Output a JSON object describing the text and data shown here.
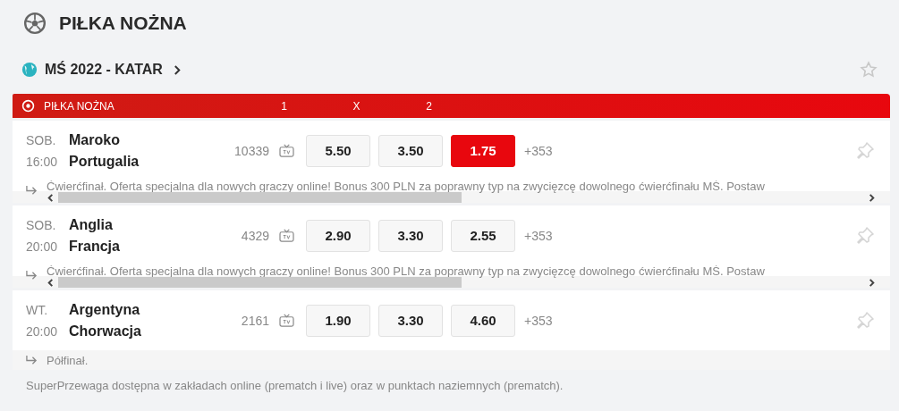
{
  "title": "PIŁKA NOŻNA",
  "league": {
    "name": "MŚ 2022 - KATAR",
    "favorite": false
  },
  "table": {
    "sport": "PIŁKA NOŻNA",
    "columns": [
      "1",
      "X",
      "2"
    ]
  },
  "matches": [
    {
      "day": "SOB.",
      "time": "16:00",
      "home": "Maroko",
      "away": "Portugalia",
      "count": "10339",
      "odds": [
        {
          "value": "5.50",
          "selected": false
        },
        {
          "value": "3.50",
          "selected": false
        },
        {
          "value": "1.75",
          "selected": true
        }
      ],
      "more": "+353",
      "pinned": false,
      "comment": "Ćwierćfinał. Oferta specjalna dla nowych graczy online! Bonus 300 PLN za poprawny typ na zwycięzcę dowolnego ćwierćfinału MŚ. Postaw",
      "scrollbar": true
    },
    {
      "day": "SOB.",
      "time": "20:00",
      "home": "Anglia",
      "away": "Francja",
      "count": "4329",
      "odds": [
        {
          "value": "2.90",
          "selected": false
        },
        {
          "value": "3.30",
          "selected": false
        },
        {
          "value": "2.55",
          "selected": false
        }
      ],
      "more": "+353",
      "pinned": false,
      "comment": "Ćwierćfinał. Oferta specjalna dla nowych graczy online! Bonus 300 PLN za poprawny typ na zwycięzcę dowolnego ćwierćfinału MŚ. Postaw",
      "scrollbar": true
    },
    {
      "day": "WT.",
      "time": "20:00",
      "home": "Argentyna",
      "away": "Chorwacja",
      "count": "2161",
      "odds": [
        {
          "value": "1.90",
          "selected": false
        },
        {
          "value": "3.30",
          "selected": false
        },
        {
          "value": "4.60",
          "selected": false
        }
      ],
      "more": "+353",
      "pinned": false,
      "comment": "Półfinał.",
      "scrollbar": false
    }
  ],
  "footer": "SuperPrzewaga dostępna w zakładach online (prematch i live) oraz w punktach naziemnych (prematch)."
}
